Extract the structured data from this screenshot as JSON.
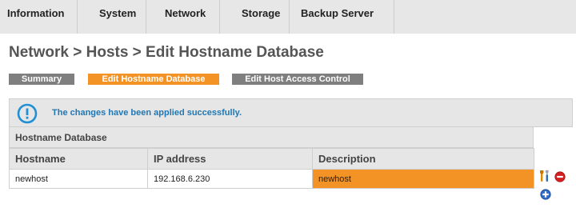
{
  "topnav": {
    "tabs": [
      "Information",
      "System",
      "Network",
      "Storage",
      "Backup Server"
    ]
  },
  "breadcrumb": "Network > Hosts > Edit Hostname Database",
  "subtabs": {
    "summary": "Summary",
    "edit_hostname_db": "Edit Hostname Database",
    "edit_host_access": "Edit Host Access Control",
    "active": "Edit Hostname Database"
  },
  "message": {
    "text": "The changes have been applied successfully.",
    "icon": "info-icon"
  },
  "table": {
    "caption": "Hostname Database",
    "columns": [
      "Hostname",
      "IP address",
      "Description"
    ],
    "rows": [
      [
        "newhost",
        "192.168.6.230",
        "newhost"
      ]
    ]
  },
  "actions": {
    "edit_icon": "edit-icon",
    "delete_icon": "delete-icon",
    "add_icon": "add-icon"
  },
  "colors": {
    "accent": "#f39325",
    "inactive_tab": "#7f7f7f",
    "message_text": "#1f77b4",
    "panel_bg": "#e6e6e6"
  }
}
